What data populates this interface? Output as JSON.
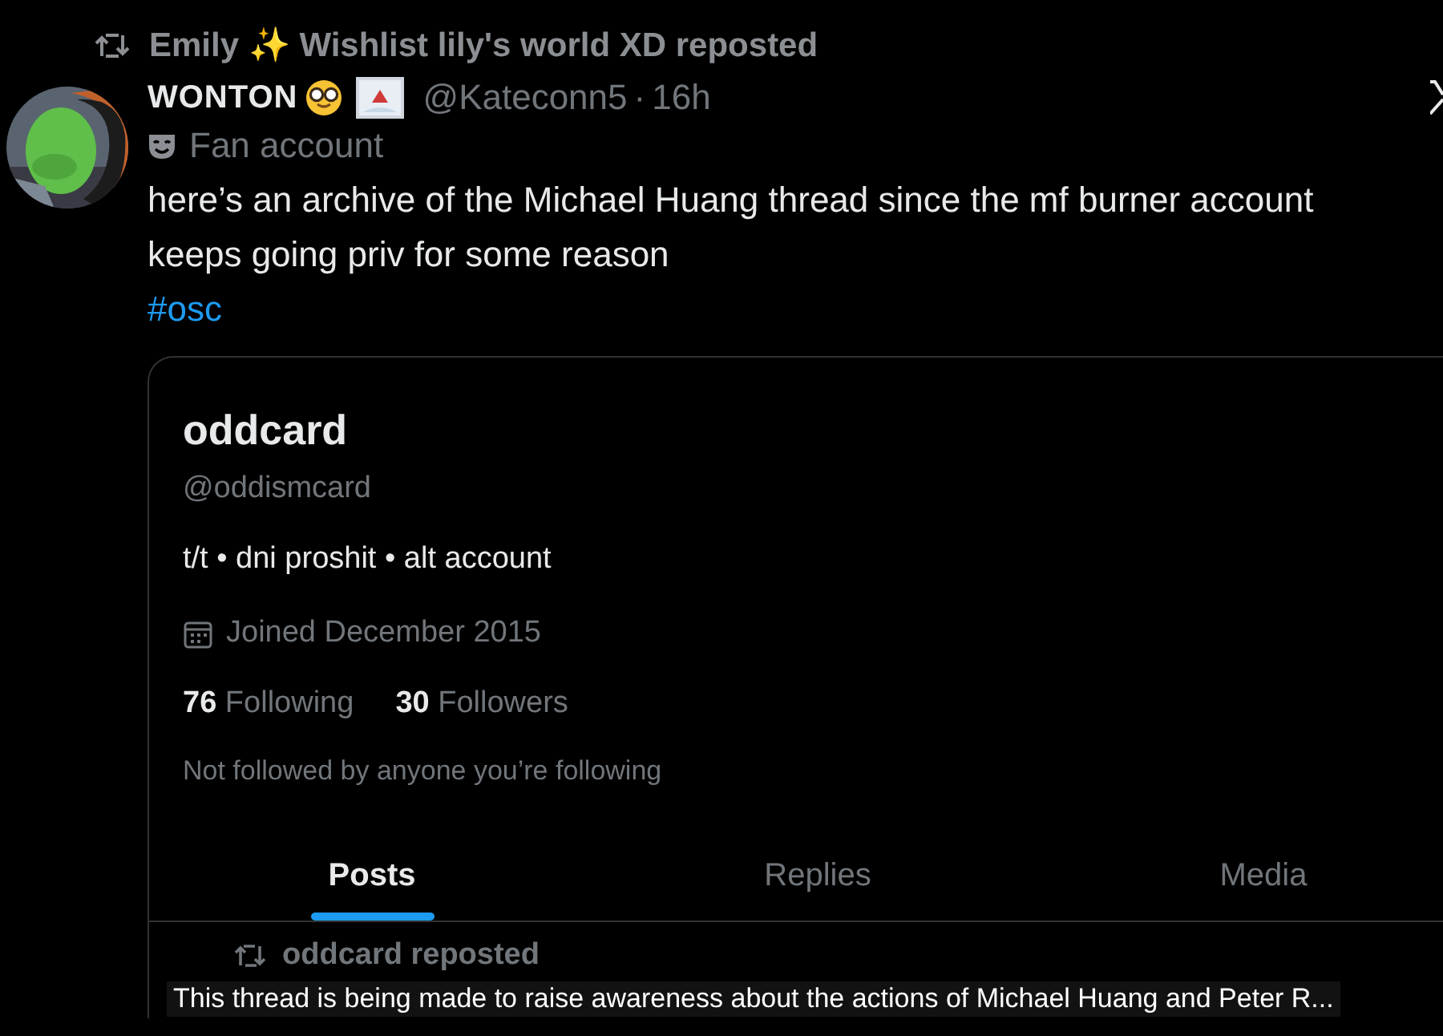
{
  "repost": {
    "text": "Emily ✨ Wishlist lily's world XD reposted"
  },
  "post": {
    "display_name": "WONTON",
    "handle": "@Kateconn5",
    "separator": "·",
    "time": "16h",
    "label": "Fan account",
    "text": "here’s an archive of the Michael Huang thread since the mf burner account keeps going priv for some reason",
    "hashtag": "#osc"
  },
  "embedded_screenshot": {
    "name": "oddcard",
    "handle": "@oddismcard",
    "bio": "t/t • dni proshit • alt account",
    "joined": "Joined December 2015",
    "following_count": "76",
    "following_label": "Following",
    "followers_count": "30",
    "followers_label": "Followers",
    "note": "Not followed by anyone you’re following",
    "tabs": [
      {
        "label": "Posts",
        "selected": true
      },
      {
        "label": "Replies",
        "selected": false
      },
      {
        "label": "Media",
        "selected": false
      }
    ],
    "repost_line": "oddcard reposted"
  },
  "caption": "This thread is being made to raise awareness about the actions of Michael Huang and Peter R..."
}
